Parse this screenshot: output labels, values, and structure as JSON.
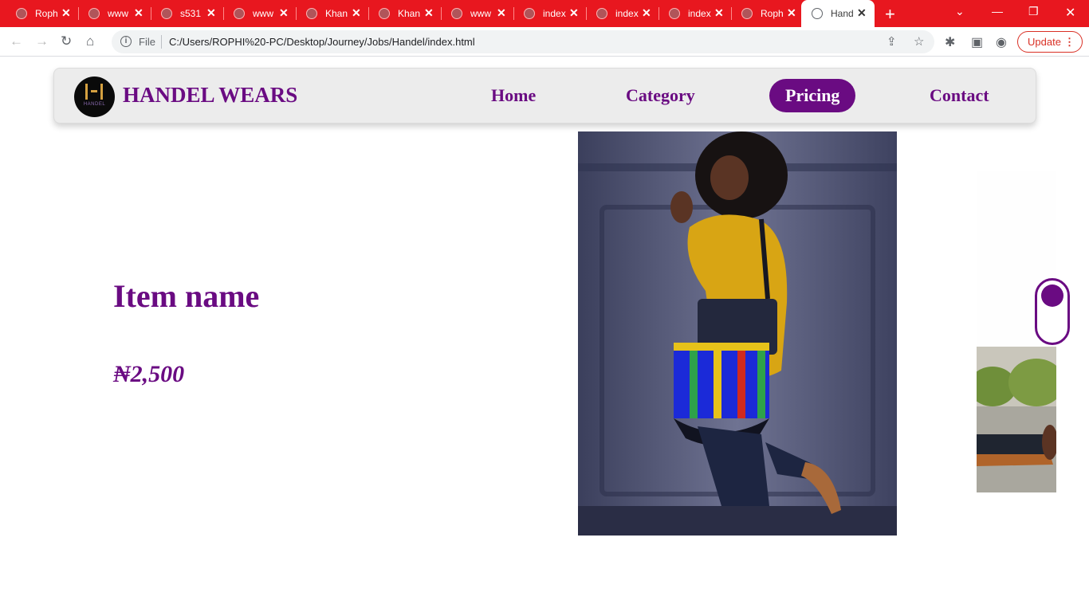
{
  "browser": {
    "tabs": [
      {
        "title": "Roph",
        "active": false
      },
      {
        "title": "www",
        "active": false
      },
      {
        "title": "s531",
        "active": false
      },
      {
        "title": "www",
        "active": false
      },
      {
        "title": "Khan",
        "active": false
      },
      {
        "title": "Khan",
        "active": false
      },
      {
        "title": "www",
        "active": false
      },
      {
        "title": "index",
        "active": false
      },
      {
        "title": "index",
        "active": false
      },
      {
        "title": "index",
        "active": false
      },
      {
        "title": "Roph",
        "active": false
      },
      {
        "title": "Hand",
        "active": true
      }
    ],
    "file_label": "File",
    "url": "C:/Users/ROPHI%20-PC/Desktop/Journey/Jobs/Handel/index.html",
    "update_label": "Update",
    "accent_color": "#e8171f"
  },
  "site": {
    "brand": "HANDEL WEARS",
    "logo_text": "HANDEL",
    "nav": [
      {
        "label": "Home",
        "active": false
      },
      {
        "label": "Category",
        "active": false
      },
      {
        "label": "Pricing",
        "active": true
      },
      {
        "label": "Contact",
        "active": false
      }
    ],
    "brand_color": "#6a0b82"
  },
  "product": {
    "name": "Item name",
    "price": "₦2,500"
  },
  "slider": {
    "state": "on"
  }
}
